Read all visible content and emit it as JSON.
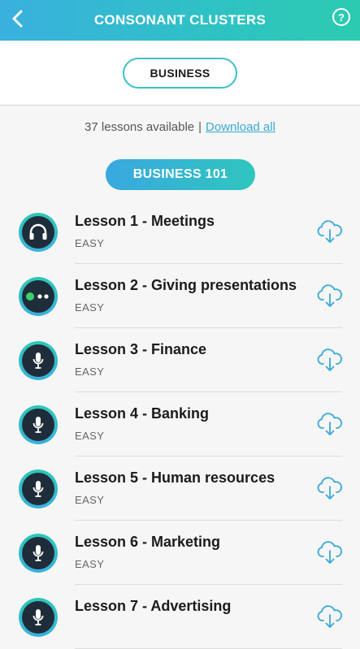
{
  "header": {
    "title": "CONSONANT CLUSTERS",
    "help_label": "?"
  },
  "category": {
    "label": "BUSINESS"
  },
  "info": {
    "count_text": "37 lessons available",
    "separator": "|",
    "download_all": "Download all"
  },
  "section": {
    "label": "BUSINESS 101"
  },
  "lessons": [
    {
      "title": "Lesson 1 - Meetings",
      "level": "EASY",
      "icon": "headphones-icon"
    },
    {
      "title": "Lesson 2 - Giving presentations",
      "level": "EASY",
      "icon": "in-progress-dots-icon"
    },
    {
      "title": "Lesson 3 - Finance",
      "level": "EASY",
      "icon": "microphone-icon"
    },
    {
      "title": "Lesson 4 - Banking",
      "level": "EASY",
      "icon": "microphone-icon"
    },
    {
      "title": "Lesson 5 - Human resources",
      "level": "EASY",
      "icon": "microphone-icon"
    },
    {
      "title": "Lesson 6 - Marketing",
      "level": "EASY",
      "icon": "microphone-icon"
    },
    {
      "title": "Lesson 7 - Advertising",
      "level": "",
      "icon": "microphone-icon"
    }
  ],
  "colors": {
    "header_start": "#3ab0df",
    "header_end": "#2ccbb0",
    "accent": "#3bbfc8",
    "link": "#3aa9d6",
    "icon_bg": "#1f2d3a",
    "progress_dot": "#3ccf6a"
  }
}
